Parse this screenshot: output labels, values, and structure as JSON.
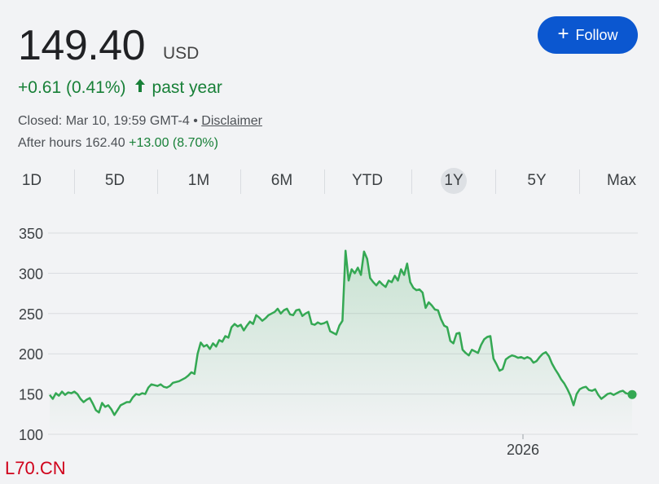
{
  "quote": {
    "price": "149.40",
    "currency": "USD",
    "change": "+0.61 (0.41%)",
    "change_arrow": "🡑",
    "period": "past year",
    "closed_text": "Closed: Mar 10, 19:59 GMT-4 •",
    "disclaimer": "Disclaimer",
    "after_hours_label": "After hours 162.40",
    "after_hours_change": "+13.00 (8.70%)"
  },
  "follow_button": {
    "icon": "plus-icon",
    "label": "Follow",
    "color": "#0b57d0"
  },
  "range_tabs": [
    {
      "label": "1D",
      "active": false
    },
    {
      "label": "5D",
      "active": false
    },
    {
      "label": "1M",
      "active": false
    },
    {
      "label": "6M",
      "active": false
    },
    {
      "label": "YTD",
      "active": false
    },
    {
      "label": "1Y",
      "active": true
    },
    {
      "label": "5Y",
      "active": false
    },
    {
      "label": "Max",
      "active": false
    }
  ],
  "colors": {
    "line": "#34a853",
    "positive": "#188038",
    "grid": "#dadce0"
  },
  "watermark": "L70.CN",
  "chart_data": {
    "type": "area",
    "ylim": [
      100,
      350
    ],
    "yticks": [
      350,
      300,
      250,
      200,
      150,
      100
    ],
    "ytick_labels": [
      "350",
      "300",
      "250",
      "200",
      "150",
      "100"
    ],
    "xtick_labels": [
      "2026"
    ],
    "grid": "horizontal",
    "values": [
      149,
      144,
      151,
      148,
      153,
      149,
      152,
      151,
      153,
      150,
      144,
      140,
      143,
      145,
      138,
      130,
      127,
      139,
      134,
      136,
      131,
      124,
      130,
      136,
      138,
      140,
      140,
      146,
      150,
      149,
      151,
      150,
      158,
      162,
      161,
      160,
      162,
      159,
      158,
      160,
      164,
      165,
      166,
      168,
      170,
      173,
      177,
      175,
      200,
      214,
      209,
      211,
      206,
      213,
      209,
      217,
      215,
      222,
      220,
      233,
      237,
      234,
      236,
      229,
      235,
      240,
      237,
      248,
      245,
      241,
      244,
      248,
      250,
      252,
      256,
      250,
      254,
      256,
      249,
      248,
      254,
      255,
      247,
      250,
      252,
      237,
      236,
      239,
      237,
      238,
      240,
      228,
      226,
      224,
      235,
      241,
      328,
      291,
      305,
      300,
      307,
      298,
      327,
      318,
      294,
      289,
      285,
      290,
      286,
      283,
      291,
      289,
      297,
      291,
      305,
      298,
      312,
      289,
      282,
      279,
      280,
      276,
      257,
      264,
      260,
      255,
      254,
      243,
      235,
      233,
      216,
      213,
      225,
      226,
      205,
      201,
      198,
      205,
      203,
      201,
      211,
      218,
      221,
      222,
      194,
      187,
      179,
      181,
      193,
      196,
      198,
      197,
      195,
      196,
      194,
      196,
      194,
      189,
      191,
      196,
      200,
      202,
      197,
      188,
      181,
      175,
      168,
      163,
      156,
      148,
      136,
      150,
      156,
      158,
      159,
      155,
      154,
      156,
      149,
      144,
      147,
      150,
      151,
      149,
      151,
      153,
      154,
      151,
      150,
      149.4
    ]
  }
}
